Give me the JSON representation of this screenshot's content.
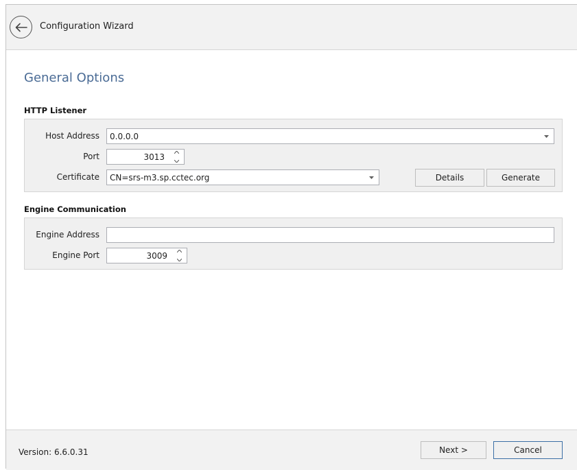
{
  "header": {
    "title": "Configuration Wizard",
    "back_icon": "arrow-left-icon"
  },
  "page": {
    "section_title": "General Options"
  },
  "http_listener": {
    "heading": "HTTP Listener",
    "host_address_label": "Host Address",
    "host_address_value": "0.0.0.0",
    "port_label": "Port",
    "port_value": "3013",
    "certificate_label": "Certificate",
    "certificate_value": "CN=srs-m3.sp.cctec.org",
    "details_label": "Details",
    "generate_label": "Generate"
  },
  "engine_communication": {
    "heading": "Engine Communication",
    "engine_address_label": "Engine Address",
    "engine_address_value": "",
    "engine_port_label": "Engine Port",
    "engine_port_value": "3009"
  },
  "footer": {
    "version": "Version: 6.6.0.31",
    "next_label": "Next >",
    "cancel_label": "Cancel"
  },
  "colors": {
    "section_title": "#4a6b95",
    "group_background": "#f0f0f0",
    "primary_border": "#3a6ea5"
  }
}
